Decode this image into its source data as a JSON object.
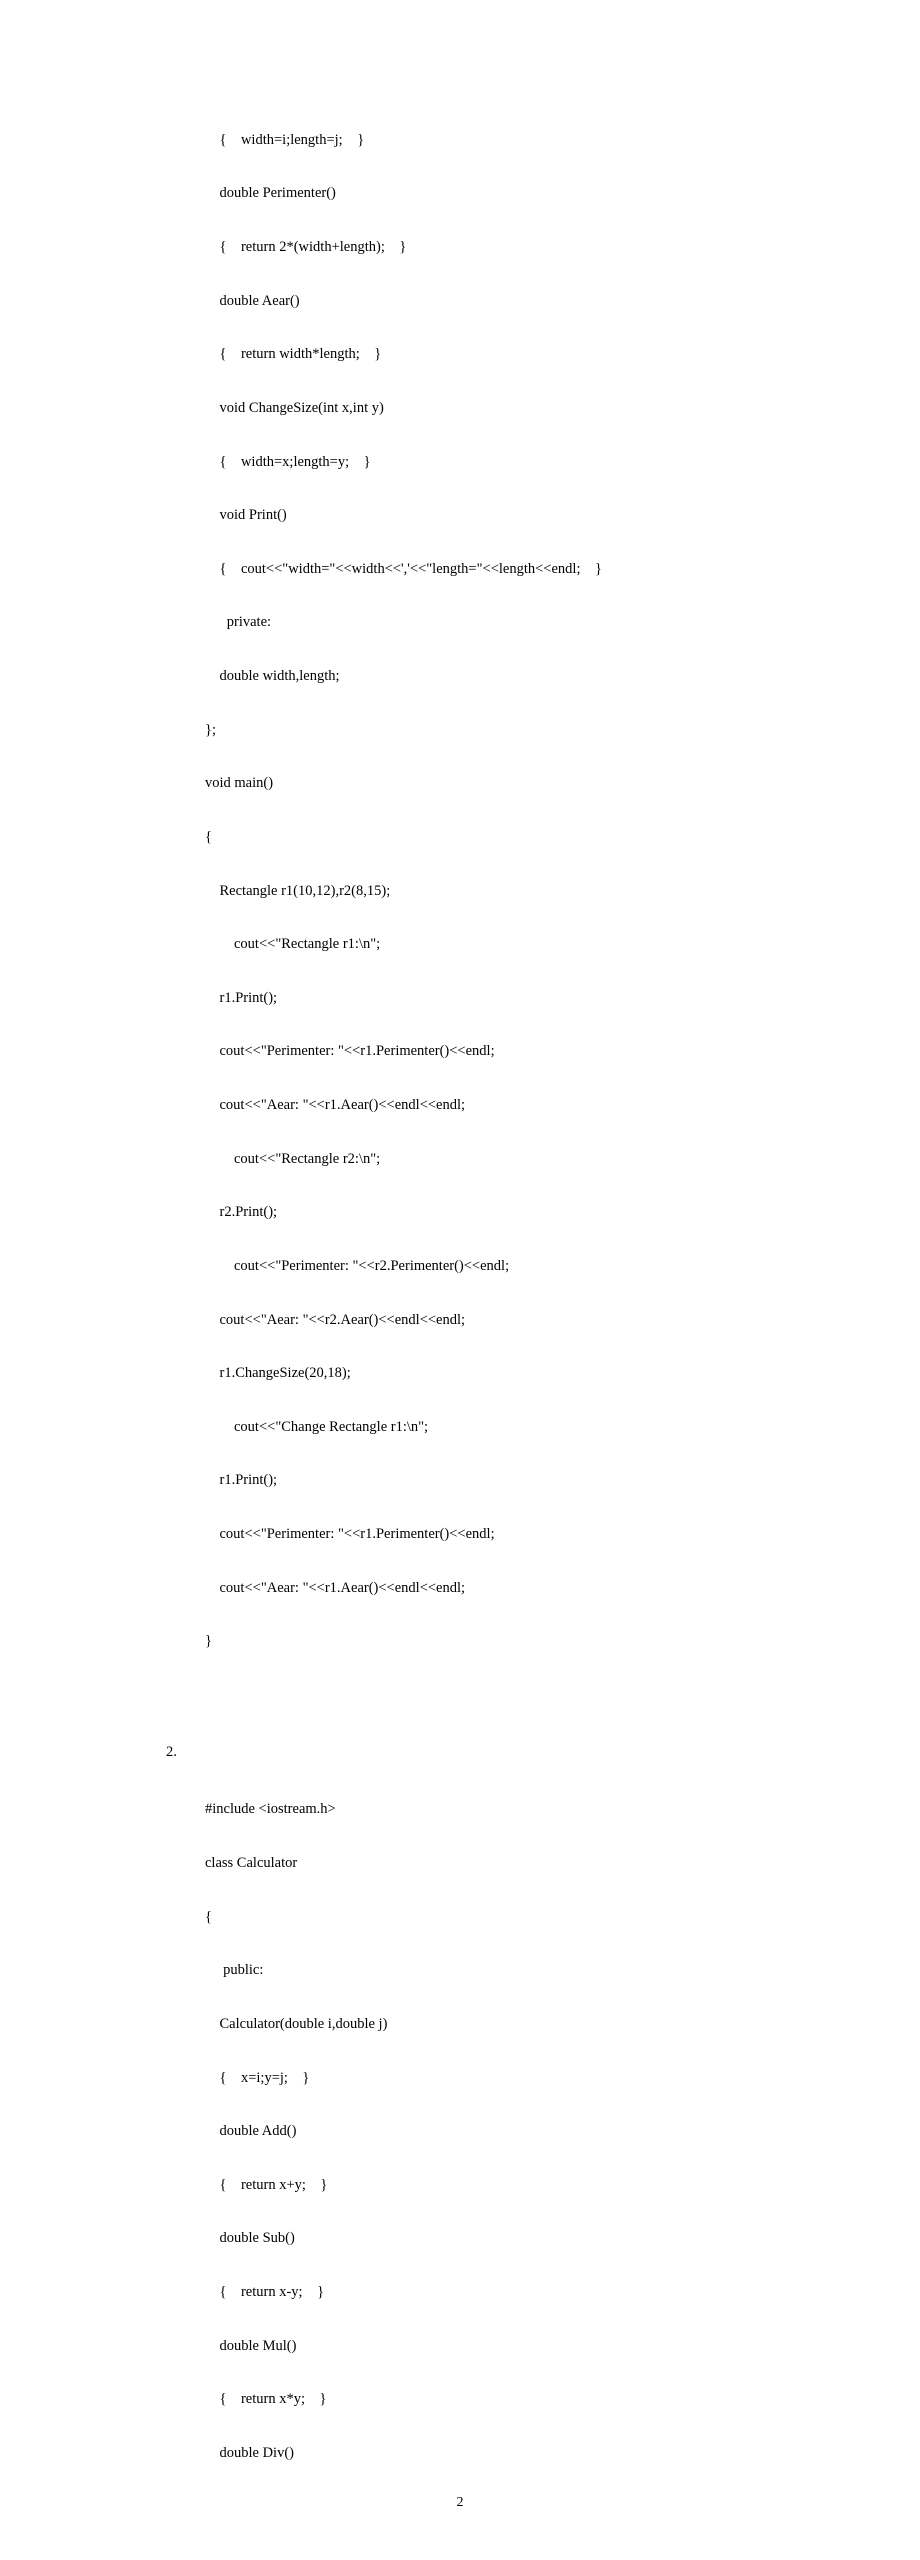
{
  "code1": {
    "l1": "    {    width=i;length=j;    }",
    "l2": "    double Perimenter()",
    "l3": "    {    return 2*(width+length);    }",
    "l4": "    double Aear()",
    "l5": "    {    return width*length;    }",
    "l6": "    void ChangeSize(int x,int y)",
    "l7": "    {    width=x;length=y;    }",
    "l8": "    void Print()",
    "l9": "    {    cout<<\"width=\"<<width<<','<<\"length=\"<<length<<endl;    }",
    "l10": "      private:",
    "l11": "    double width,length;",
    "l12": "};",
    "l13": "void main()",
    "l14": "{",
    "l15": "    Rectangle r1(10,12),r2(8,15);",
    "l16": "        cout<<\"Rectangle r1:\\n\";",
    "l17": "    r1.Print();",
    "l18": "    cout<<\"Perimenter: \"<<r1.Perimenter()<<endl;",
    "l19": "    cout<<\"Aear: \"<<r1.Aear()<<endl<<endl;",
    "l20": "        cout<<\"Rectangle r2:\\n\";",
    "l21": "    r2.Print();",
    "l22": "        cout<<\"Perimenter: \"<<r2.Perimenter()<<endl;",
    "l23": "    cout<<\"Aear: \"<<r2.Aear()<<endl<<endl;",
    "l24": "    r1.ChangeSize(20,18);",
    "l25": "        cout<<\"Change Rectangle r1:\\n\";",
    "l26": "    r1.Print();",
    "l27": "    cout<<\"Perimenter: \"<<r1.Perimenter()<<endl;",
    "l28": "    cout<<\"Aear: \"<<r1.Aear()<<endl<<endl;",
    "l29": "}"
  },
  "section2_label": "2.",
  "code2": {
    "l1": "#include <iostream.h>",
    "l2": "class Calculator",
    "l3": "{",
    "l4": "     public:",
    "l5": "    Calculator(double i,double j)",
    "l6": "    {    x=i;y=j;    }",
    "l7": "    double Add()",
    "l8": "    {    return x+y;    }",
    "l9": "    double Sub()",
    "l10": "    {    return x-y;    }",
    "l11": "    double Mul()",
    "l12": "    {    return x*y;    }",
    "l13": "    double Div()"
  },
  "page_number": "2"
}
